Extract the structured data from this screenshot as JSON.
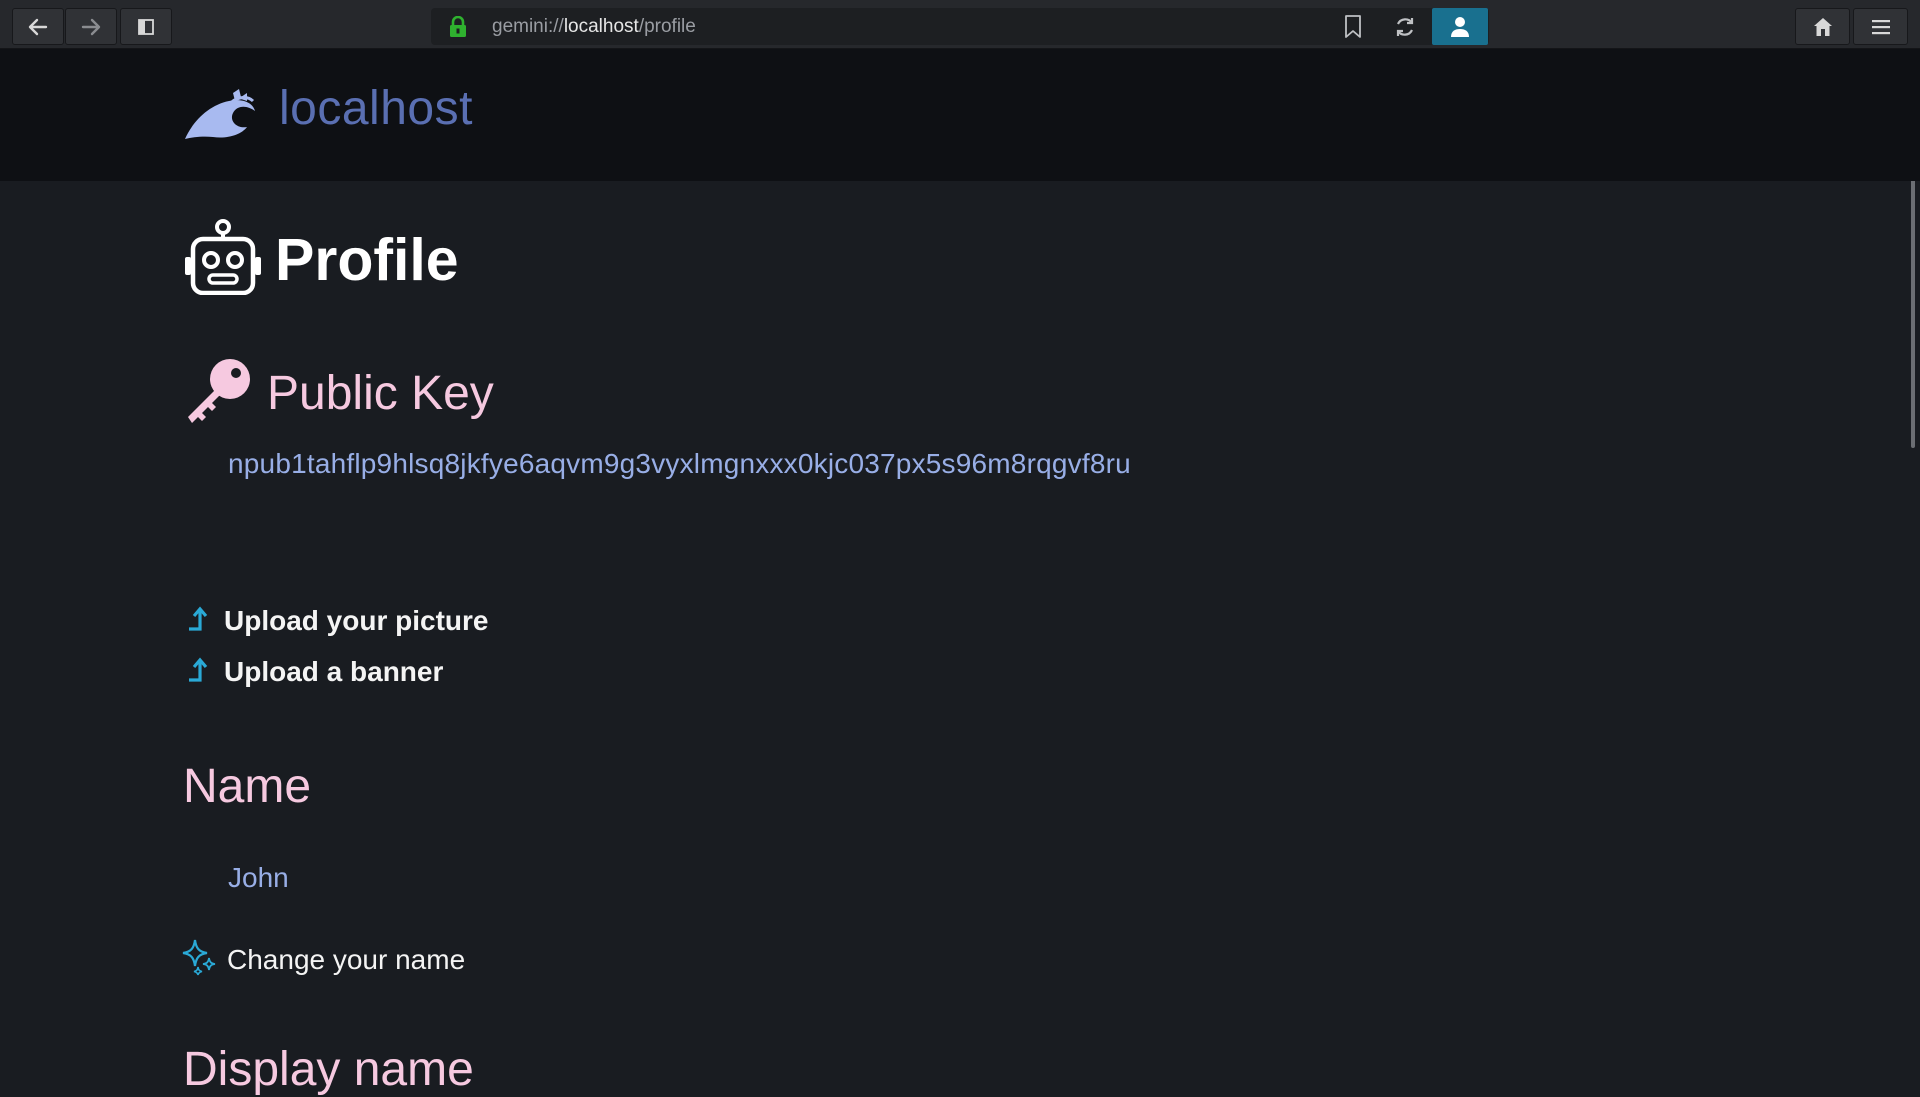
{
  "browser": {
    "url_scheme": "gemini://",
    "url_host": "localhost",
    "url_path": "/profile",
    "icons": [
      "back-arrow-icon",
      "forward-arrow-icon",
      "sidebar-toggle-icon",
      "lock-icon",
      "bookmark-icon",
      "reload-icon",
      "identity-icon",
      "home-icon",
      "menu-icon"
    ],
    "accent_color": "#19708f",
    "lock_color": "#2fb12f"
  },
  "site": {
    "title": "localhost",
    "logo_icon": "wave-icon",
    "title_color": "#5a6fb2"
  },
  "page": {
    "heading": "Profile",
    "heading_icon": "robot-icon",
    "public_key": {
      "heading": "Public Key",
      "icon": "key-icon",
      "value": "npub1tahflp9hlsq8jkfye6aqvm9g3vyxlmgnxxx0kjc037px5s96m8rqgvf8ru"
    },
    "uploads": [
      {
        "label": "Upload your picture",
        "icon": "upload-arrow-icon"
      },
      {
        "label": "Upload a banner",
        "icon": "upload-arrow-icon"
      }
    ],
    "name": {
      "heading": "Name",
      "value": "John",
      "action": "Change your name",
      "action_icon": "sparkle-icon"
    },
    "display_name": {
      "heading": "Display name"
    },
    "colors": {
      "heading_pink": "#f6c9e0",
      "link_blue": "#98aee6",
      "upload_icon_cyan": "#2aa9d6"
    }
  }
}
